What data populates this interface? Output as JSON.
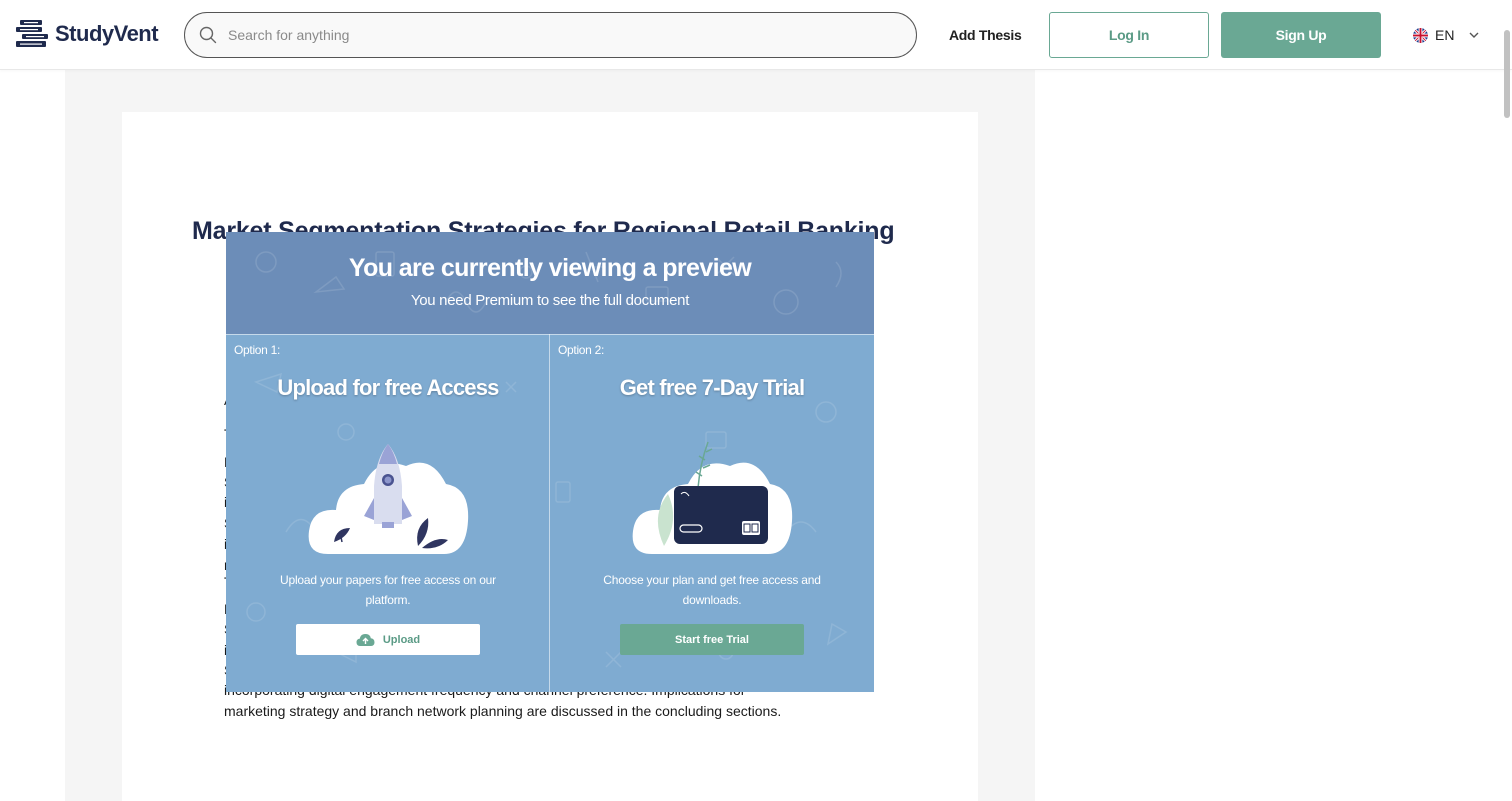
{
  "header": {
    "logo_text": "StudyVent",
    "search_placeholder": "Search for anything",
    "add_thesis_label": "Add Thesis",
    "login_label": "Log In",
    "signup_label": "Sign Up",
    "language": "EN"
  },
  "document": {
    "title": "Market Segmentation Strategies for Regional Retail Banking",
    "visible_line_1": "incorporating digital engagement frequency and channel preference. Implications for",
    "visible_line_2": "marketing strategy and branch network planning are discussed in the concluding sections.",
    "line_fragments": [
      "A",
      "T",
      "F",
      "S",
      "i",
      "S",
      "i",
      "r",
      "T",
      "F",
      "S",
      "i",
      "S"
    ]
  },
  "preview": {
    "title": "You are currently viewing a preview",
    "subtitle": "You need Premium to see the full document",
    "option1": {
      "label": "Option 1:",
      "heading": "Upload for free Access",
      "description": "Upload your papers for free access on our platform.",
      "button_label": "Upload"
    },
    "option2": {
      "label": "Option 2:",
      "heading": "Get free 7-Day Trial",
      "description": "Choose your plan and get free access and downloads.",
      "button_label": "Start free Trial"
    }
  },
  "colors": {
    "brand_navy": "#1f2a4d",
    "accent_green": "#6aa894",
    "overlay_top": "#6c8db8",
    "overlay_bottom": "#7fabd1"
  },
  "icons": [
    "logo-books-icon",
    "search-icon",
    "uk-flag-icon",
    "chevron-down-icon",
    "cloud-upload-icon",
    "rocket-illustration",
    "credit-card-illustration"
  ]
}
